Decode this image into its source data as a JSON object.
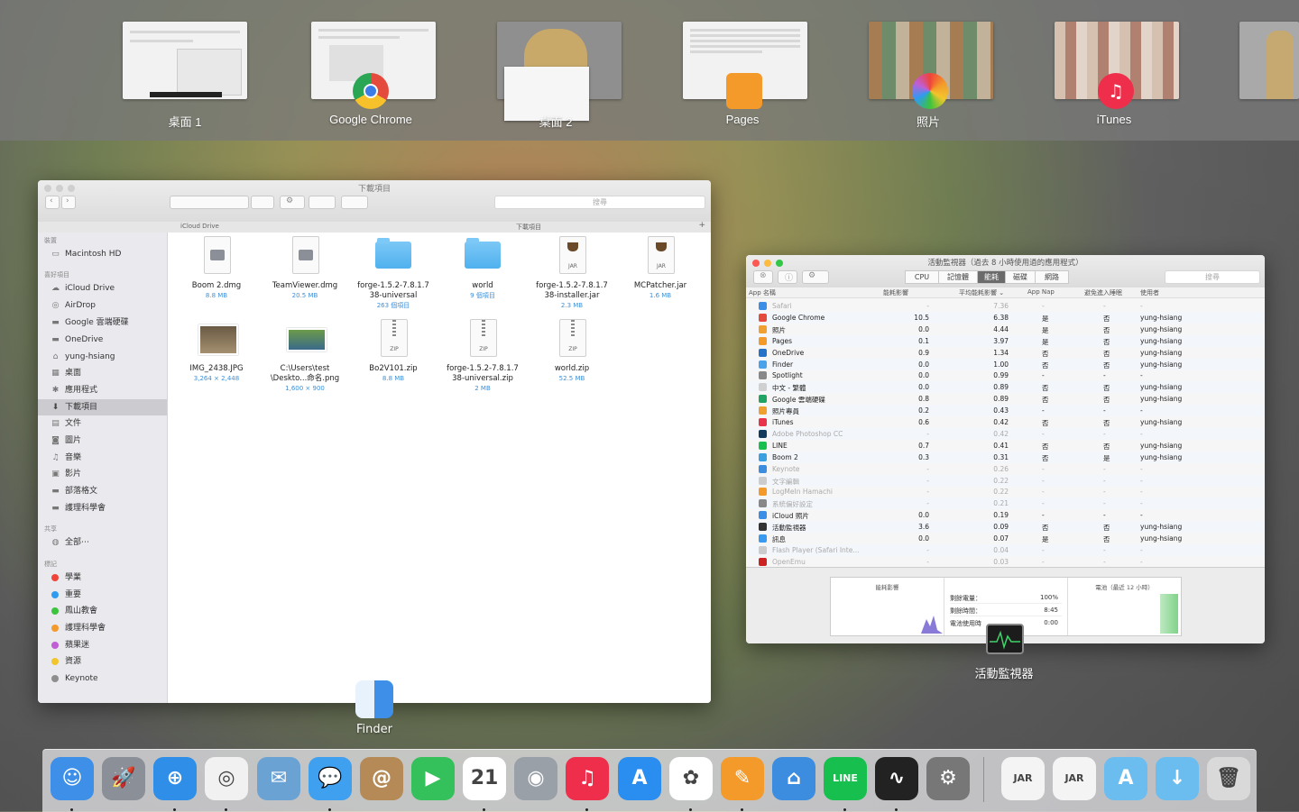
{
  "spaces": [
    {
      "label": "桌面 1"
    },
    {
      "label": "Google Chrome"
    },
    {
      "label": "桌面 2"
    },
    {
      "label": "Pages"
    },
    {
      "label": "照片"
    },
    {
      "label": "iTunes"
    }
  ],
  "finder": {
    "title": "下載項目",
    "search_placeholder": "搜尋",
    "path_left": "iCloud Drive",
    "path_right": "下載項目",
    "sidebar": {
      "devices_header": "裝置",
      "devices": [
        {
          "label": "Macintosh HD",
          "icon": "hdd-icon"
        }
      ],
      "favorites_header": "喜好項目",
      "favorites": [
        {
          "label": "iCloud Drive",
          "icon": "cloud-icon"
        },
        {
          "label": "AirDrop",
          "icon": "airdrop-icon"
        },
        {
          "label": "Google 雲端硬碟",
          "icon": "folder-icon"
        },
        {
          "label": "OneDrive",
          "icon": "folder-icon"
        },
        {
          "label": "yung-hsiang",
          "icon": "home-icon"
        },
        {
          "label": "桌面",
          "icon": "desktop-icon"
        },
        {
          "label": "應用程式",
          "icon": "applications-icon"
        },
        {
          "label": "下載項目",
          "icon": "downloads-icon"
        },
        {
          "label": "文件",
          "icon": "documents-icon"
        },
        {
          "label": "圖片",
          "icon": "camera-icon"
        },
        {
          "label": "音樂",
          "icon": "music-icon"
        },
        {
          "label": "影片",
          "icon": "movies-icon"
        },
        {
          "label": "部落格文",
          "icon": "folder-icon"
        },
        {
          "label": "護理科學會",
          "icon": "folder-icon"
        }
      ],
      "shared_header": "共享",
      "shared": [
        {
          "label": "全部⋯",
          "icon": "globe-icon"
        }
      ],
      "tags_header": "標記",
      "tags": [
        {
          "label": "學業",
          "color": "#f0433a"
        },
        {
          "label": "重要",
          "color": "#2f9bf0"
        },
        {
          "label": "鳳山教會",
          "color": "#3cc43c"
        },
        {
          "label": "護理科學會",
          "color": "#f39a2b"
        },
        {
          "label": "蘋果迷",
          "color": "#c05ed6"
        },
        {
          "label": "資源",
          "color": "#f3c52c"
        },
        {
          "label": "Keynote",
          "color": "#8e8e8e"
        }
      ]
    },
    "files": [
      {
        "name": "Boom 2.dmg",
        "meta": "8.8 MB",
        "kind": "dmg"
      },
      {
        "name": "TeamViewer.dmg",
        "meta": "20.5 MB",
        "kind": "dmg"
      },
      {
        "name": "forge-1.5.2-7.8.1.7\n38-universal",
        "meta": "263 個項目",
        "kind": "folder"
      },
      {
        "name": "world",
        "meta": "9 個項目",
        "kind": "folder"
      },
      {
        "name": "forge-1.5.2-7.8.1.7\n38-installer.jar",
        "meta": "2.3 MB",
        "kind": "jar"
      },
      {
        "name": "MCPatcher.jar",
        "meta": "1.6 MB",
        "kind": "jar"
      },
      {
        "name": "IMG_2438.JPG",
        "meta": "3,264 × 2,448",
        "kind": "image"
      },
      {
        "name": "C:\\Users\\test\n\\Deskto...命名.png",
        "meta": "1,600 × 900",
        "kind": "image"
      },
      {
        "name": "Bo2V101.zip",
        "meta": "8.8 MB",
        "kind": "zip"
      },
      {
        "name": "forge-1.5.2-7.8.1.7\n38-universal.zip",
        "meta": "2 MB",
        "kind": "zip"
      },
      {
        "name": "world.zip",
        "meta": "52.5 MB",
        "kind": "zip"
      }
    ],
    "window_label": "Finder"
  },
  "activity": {
    "title": "活動監視器（過去 8 小時使用過的應用程式）",
    "tabs": [
      "CPU",
      "記憶體",
      "能耗",
      "磁碟",
      "網路"
    ],
    "active_tab": "能耗",
    "search_placeholder": "搜尋",
    "columns": [
      "App 名稱",
      "能耗影響",
      "平均能耗影響 ⌄",
      "App Nap",
      "避免進入睡眠",
      "使用者"
    ],
    "rows": [
      {
        "name": "Safari",
        "impact": "-",
        "avg": "7.36",
        "nap": "-",
        "sleep": "-",
        "user": "-",
        "dim": true,
        "color": "#3a8ee6"
      },
      {
        "name": "Google Chrome",
        "impact": "10.5",
        "avg": "6.38",
        "nap": "是",
        "sleep": "否",
        "user": "yung-hsiang",
        "dim": false,
        "color": "#e44b3c"
      },
      {
        "name": "照片",
        "impact": "0.0",
        "avg": "4.44",
        "nap": "是",
        "sleep": "否",
        "user": "yung-hsiang",
        "dim": false,
        "color": "#f0a030"
      },
      {
        "name": "Pages",
        "impact": "0.1",
        "avg": "3.97",
        "nap": "是",
        "sleep": "否",
        "user": "yung-hsiang",
        "dim": false,
        "color": "#f39a2b"
      },
      {
        "name": "OneDrive",
        "impact": "0.9",
        "avg": "1.34",
        "nap": "否",
        "sleep": "否",
        "user": "yung-hsiang",
        "dim": false,
        "color": "#2573c9"
      },
      {
        "name": "Finder",
        "impact": "0.0",
        "avg": "1.00",
        "nap": "否",
        "sleep": "否",
        "user": "yung-hsiang",
        "dim": false,
        "color": "#4aa3ea"
      },
      {
        "name": "Spotlight",
        "impact": "0.0",
        "avg": "0.99",
        "nap": "-",
        "sleep": "-",
        "user": "-",
        "dim": false,
        "color": "#888888"
      },
      {
        "name": "中文 - 繁體",
        "impact": "0.0",
        "avg": "0.89",
        "nap": "否",
        "sleep": "否",
        "user": "yung-hsiang",
        "dim": false,
        "color": "#d0d0d0"
      },
      {
        "name": "Google 雲端硬碟",
        "impact": "0.8",
        "avg": "0.89",
        "nap": "否",
        "sleep": "否",
        "user": "yung-hsiang",
        "dim": false,
        "color": "#1fa463"
      },
      {
        "name": "照片專員",
        "impact": "0.2",
        "avg": "0.43",
        "nap": "-",
        "sleep": "-",
        "user": "-",
        "dim": false,
        "color": "#f0a030"
      },
      {
        "name": "iTunes",
        "impact": "0.6",
        "avg": "0.42",
        "nap": "否",
        "sleep": "否",
        "user": "yung-hsiang",
        "dim": false,
        "color": "#e8334a"
      },
      {
        "name": "Adobe Photoshop CC",
        "impact": "-",
        "avg": "0.42",
        "nap": "-",
        "sleep": "-",
        "user": "-",
        "dim": true,
        "color": "#123a5e"
      },
      {
        "name": "LINE",
        "impact": "0.7",
        "avg": "0.41",
        "nap": "否",
        "sleep": "否",
        "user": "yung-hsiang",
        "dim": false,
        "color": "#17c04e"
      },
      {
        "name": "Boom 2",
        "impact": "0.3",
        "avg": "0.31",
        "nap": "否",
        "sleep": "是",
        "user": "yung-hsiang",
        "dim": false,
        "color": "#3aa0e0"
      },
      {
        "name": "Keynote",
        "impact": "-",
        "avg": "0.26",
        "nap": "-",
        "sleep": "-",
        "user": "-",
        "dim": true,
        "color": "#3c8de0"
      },
      {
        "name": "文字編輯",
        "impact": "-",
        "avg": "0.22",
        "nap": "-",
        "sleep": "-",
        "user": "-",
        "dim": true,
        "color": "#cccccc"
      },
      {
        "name": "LogMeIn Hamachi",
        "impact": "-",
        "avg": "0.22",
        "nap": "-",
        "sleep": "-",
        "user": "-",
        "dim": true,
        "color": "#f39a2b"
      },
      {
        "name": "系統偏好設定",
        "impact": "-",
        "avg": "0.21",
        "nap": "-",
        "sleep": "-",
        "user": "-",
        "dim": true,
        "color": "#888888"
      },
      {
        "name": "iCloud 照片",
        "impact": "0.0",
        "avg": "0.19",
        "nap": "-",
        "sleep": "-",
        "user": "-",
        "dim": false,
        "color": "#3a8ee6"
      },
      {
        "name": "活動監視器",
        "impact": "3.6",
        "avg": "0.09",
        "nap": "否",
        "sleep": "否",
        "user": "yung-hsiang",
        "dim": false,
        "color": "#333333"
      },
      {
        "name": "訊息",
        "impact": "0.0",
        "avg": "0.07",
        "nap": "是",
        "sleep": "否",
        "user": "yung-hsiang",
        "dim": false,
        "color": "#3a9af0"
      },
      {
        "name": "Flash Player (Safari Inte...",
        "impact": "-",
        "avg": "0.04",
        "nap": "-",
        "sleep": "-",
        "user": "-",
        "dim": true,
        "color": "#cccccc"
      },
      {
        "name": "OpenEmu",
        "impact": "-",
        "avg": "0.03",
        "nap": "-",
        "sleep": "-",
        "user": "-",
        "dim": true,
        "color": "#cc2222"
      }
    ],
    "footer": {
      "energy_label": "能耗影響",
      "battery_label": "電池（最近 12 小時）",
      "remaining_charge_label": "剩餘電量：",
      "remaining_charge": "100%",
      "remaining_time_label": "剩餘時間：",
      "remaining_time": "8:45",
      "battery_time_label": "電池使用時",
      "battery_time": "0:00"
    },
    "window_label": "活動監視器"
  },
  "dock": {
    "apps": [
      {
        "name": "finder-icon",
        "bg": "#3d8fe8",
        "glyph": "☺",
        "running": true
      },
      {
        "name": "launchpad-icon",
        "bg": "#8a8f98",
        "glyph": "🚀",
        "running": false
      },
      {
        "name": "safari-icon",
        "bg": "#2f8fe8",
        "glyph": "⊕",
        "running": true
      },
      {
        "name": "chrome-icon",
        "bg": "#f1f1f1",
        "glyph": "◎",
        "running": true
      },
      {
        "name": "mail-icon",
        "bg": "#6aa2d4",
        "glyph": "✉",
        "running": false
      },
      {
        "name": "messages-icon",
        "bg": "#3fa0f0",
        "glyph": "💬",
        "running": true
      },
      {
        "name": "contacts-icon",
        "bg": "#b58a56",
        "glyph": "@",
        "running": false
      },
      {
        "name": "facetime-icon",
        "bg": "#34c05a",
        "glyph": "▶",
        "running": false
      },
      {
        "name": "calendar-icon",
        "bg": "#ffffff",
        "glyph": "21",
        "running": true
      },
      {
        "name": "preview-icon",
        "bg": "#9aa0a8",
        "glyph": "◉",
        "running": false
      },
      {
        "name": "itunes-icon",
        "bg": "#ee2e4a",
        "glyph": "♫",
        "running": true
      },
      {
        "name": "app-store-icon",
        "bg": "#2a8ef0",
        "glyph": "A",
        "running": false
      },
      {
        "name": "photos-icon",
        "bg": "#ffffff",
        "glyph": "✿",
        "running": true
      },
      {
        "name": "pages-icon",
        "bg": "#f39a2b",
        "glyph": "✎",
        "running": true
      },
      {
        "name": "keynote-icon",
        "bg": "#3c8de0",
        "glyph": "⌂",
        "running": false
      },
      {
        "name": "line-icon",
        "bg": "#17c04e",
        "glyph": "LINE",
        "running": true
      },
      {
        "name": "activity-monitor-icon",
        "bg": "#222222",
        "glyph": "∿",
        "running": true
      },
      {
        "name": "system-preferences-icon",
        "bg": "#777777",
        "glyph": "⚙",
        "running": false
      },
      {
        "name": "jar-file-icon",
        "bg": "#f4f4f4",
        "glyph": "JAR",
        "running": false
      },
      {
        "name": "jar-file-icon-2",
        "bg": "#f4f4f4",
        "glyph": "JAR",
        "running": false
      },
      {
        "name": "applications-folder-icon",
        "bg": "#6bbdf0",
        "glyph": "A",
        "running": false
      },
      {
        "name": "downloads-folder-icon",
        "bg": "#6bbdf0",
        "glyph": "↓",
        "running": false
      },
      {
        "name": "trash-icon",
        "bg": "#d9d9d9",
        "glyph": "🗑",
        "running": false
      }
    ]
  }
}
